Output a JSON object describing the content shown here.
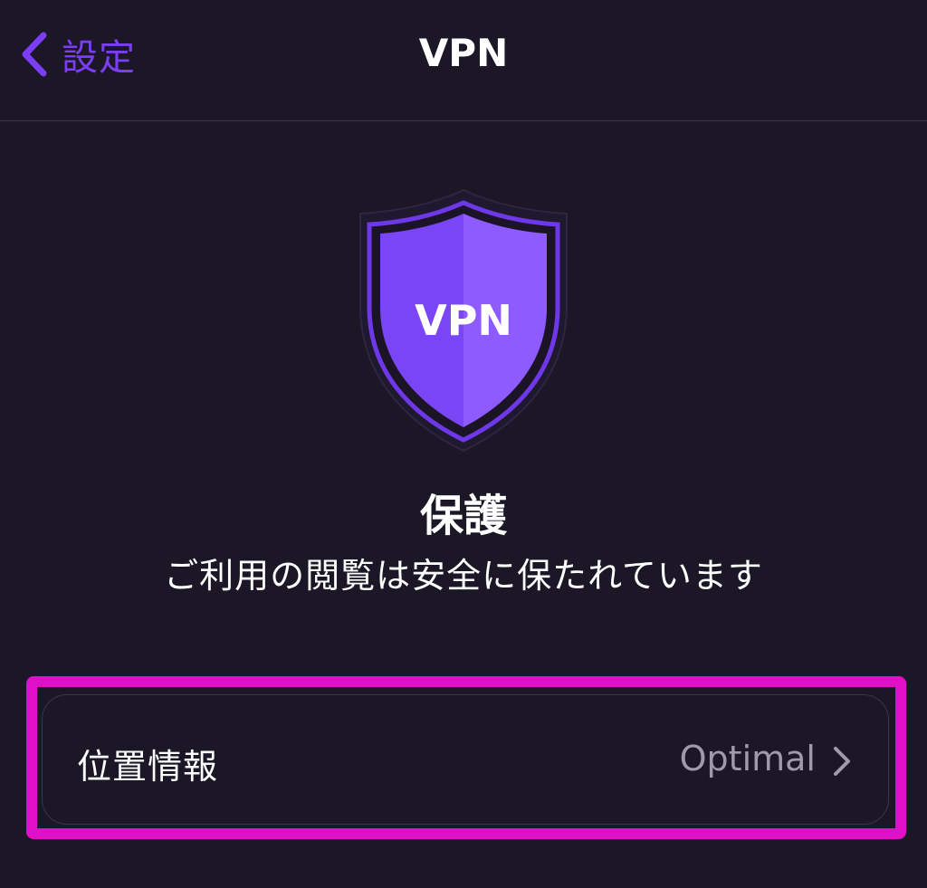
{
  "navbar": {
    "back_label": "設定",
    "title": "VPN"
  },
  "shield": {
    "label": "VPN",
    "icon": "shield-icon",
    "color_left": "#7a45f4",
    "color_right": "#8d5bff",
    "outline": "#6e38e8"
  },
  "status": {
    "title": "保護",
    "subtitle": "ご利用の閲覧は安全に保たれています"
  },
  "location": {
    "label": "位置情報",
    "value": "Optimal"
  },
  "colors": {
    "background": "#1b1727",
    "accent": "#7b3df5",
    "highlight": "#e10fc7"
  }
}
